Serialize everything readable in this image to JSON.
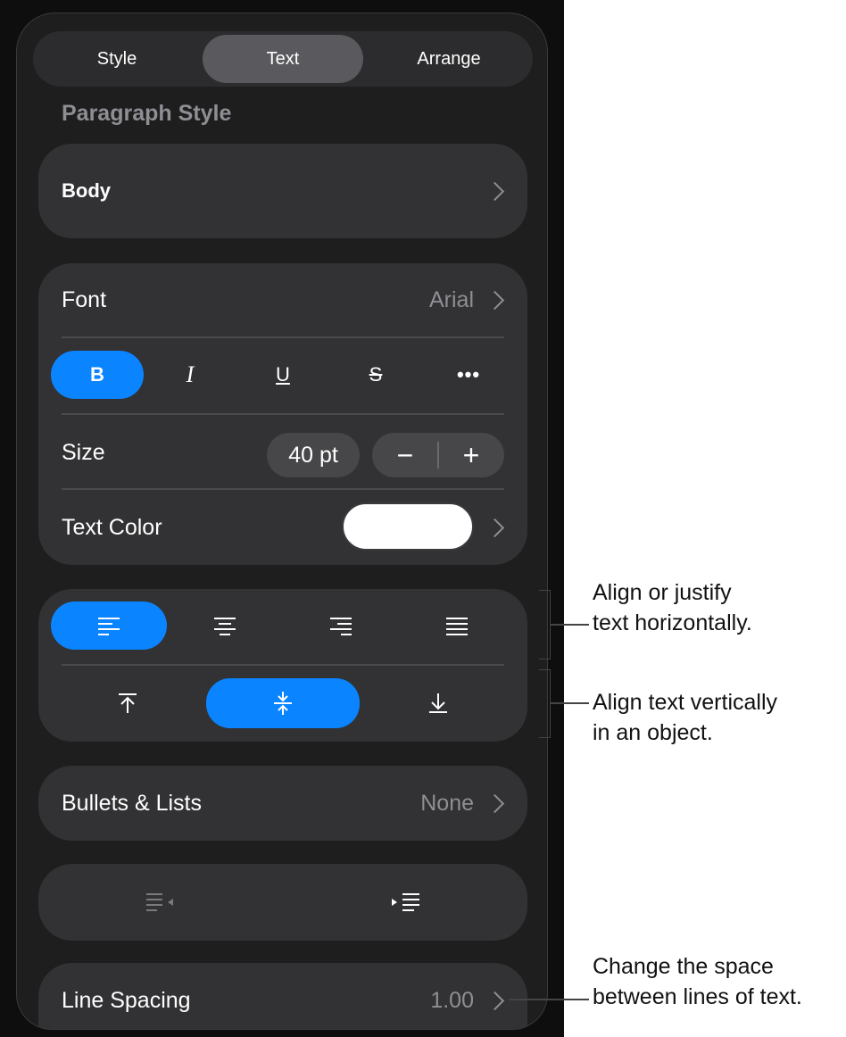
{
  "tabs": [
    {
      "label": "Style",
      "active": false
    },
    {
      "label": "Text",
      "active": true
    },
    {
      "label": "Arrange",
      "active": false
    }
  ],
  "paragraph_style": {
    "section_label": "Paragraph Style",
    "value": "Body"
  },
  "font": {
    "label": "Font",
    "value": "Arial"
  },
  "format_buttons": {
    "bold": "B",
    "italic": "I",
    "underline": "U",
    "strikethrough": "S",
    "more": "•••"
  },
  "size": {
    "label": "Size",
    "value": "40 pt",
    "decrease": "−",
    "increase": "+"
  },
  "text_color": {
    "label": "Text Color",
    "swatch": "#ffffff"
  },
  "horizontal_align": {
    "icons": [
      "align-left-icon",
      "align-center-icon",
      "align-right-icon",
      "justify-icon"
    ],
    "selected": "align-left-icon"
  },
  "vertical_align": {
    "icons": [
      "align-top-icon",
      "align-middle-icon",
      "align-bottom-icon"
    ],
    "selected": "align-middle-icon"
  },
  "bullets": {
    "label": "Bullets & Lists",
    "value": "None"
  },
  "indent": {
    "icons": [
      "decrease-indent-icon",
      "increase-indent-icon"
    ]
  },
  "line_spacing": {
    "label": "Line Spacing",
    "value": "1.00"
  },
  "callouts": {
    "horizontal": [
      "Align or justify",
      "text horizontally."
    ],
    "vertical": [
      "Align text vertically",
      "in an object."
    ],
    "spacing": [
      "Change the space",
      "between lines of text."
    ]
  },
  "colors": {
    "accent": "#0a84ff",
    "panel": "#1e1e1f",
    "card": "#323234",
    "secondary_text": "#8e8e93"
  }
}
